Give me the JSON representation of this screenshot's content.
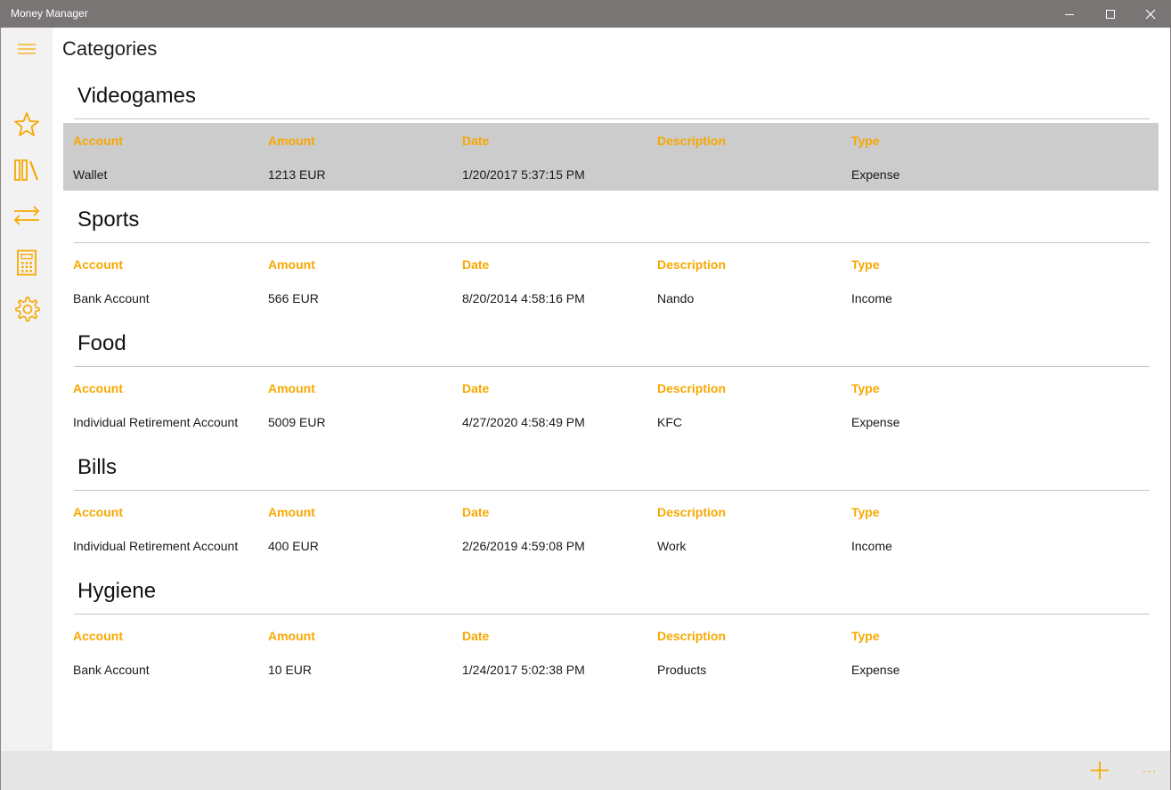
{
  "window": {
    "title": "Money Manager",
    "controls": [
      "minimize-icon",
      "maximize-icon",
      "close-icon"
    ]
  },
  "colors": {
    "accent": "#f7a800",
    "titlebar": "#797574",
    "selected_row": "#cccccc",
    "nav_bg": "#f2f2f2",
    "appbar_bg": "#e6e6e6"
  },
  "nav": {
    "items": [
      {
        "icon": "hamburger-menu-icon"
      },
      {
        "icon": "star-icon"
      },
      {
        "icon": "library-icon"
      },
      {
        "icon": "transfer-arrows-icon"
      },
      {
        "icon": "calculator-icon"
      },
      {
        "icon": "gear-icon"
      }
    ]
  },
  "page": {
    "title": "Categories"
  },
  "columns": {
    "account": "Account",
    "amount": "Amount",
    "date": "Date",
    "description": "Description",
    "type": "Type"
  },
  "categories": [
    {
      "name": "Videogames",
      "selected": true,
      "row": {
        "account": "Wallet",
        "amount": "1213 EUR",
        "date": "1/20/2017 5:37:15 PM",
        "description": "",
        "type": "Expense"
      }
    },
    {
      "name": "Sports",
      "selected": false,
      "row": {
        "account": "Bank Account",
        "amount": "566 EUR",
        "date": "8/20/2014 4:58:16 PM",
        "description": "Nando",
        "type": "Income"
      }
    },
    {
      "name": "Food",
      "selected": false,
      "row": {
        "account": "Individual Retirement Account",
        "amount": "5009 EUR",
        "date": "4/27/2020 4:58:49 PM",
        "description": "KFC",
        "type": "Expense"
      }
    },
    {
      "name": "Bills",
      "selected": false,
      "row": {
        "account": "Individual Retirement Account",
        "amount": "400 EUR",
        "date": "2/26/2019 4:59:08 PM",
        "description": "Work",
        "type": "Income"
      }
    },
    {
      "name": "Hygiene",
      "selected": false,
      "row": {
        "account": "Bank Account",
        "amount": "10 EUR",
        "date": "1/24/2017 5:02:38 PM",
        "description": "Products",
        "type": "Expense"
      }
    }
  ],
  "appbar": {
    "add_icon": "add-icon",
    "more_icon": "more-icon",
    "more_label": "···"
  }
}
